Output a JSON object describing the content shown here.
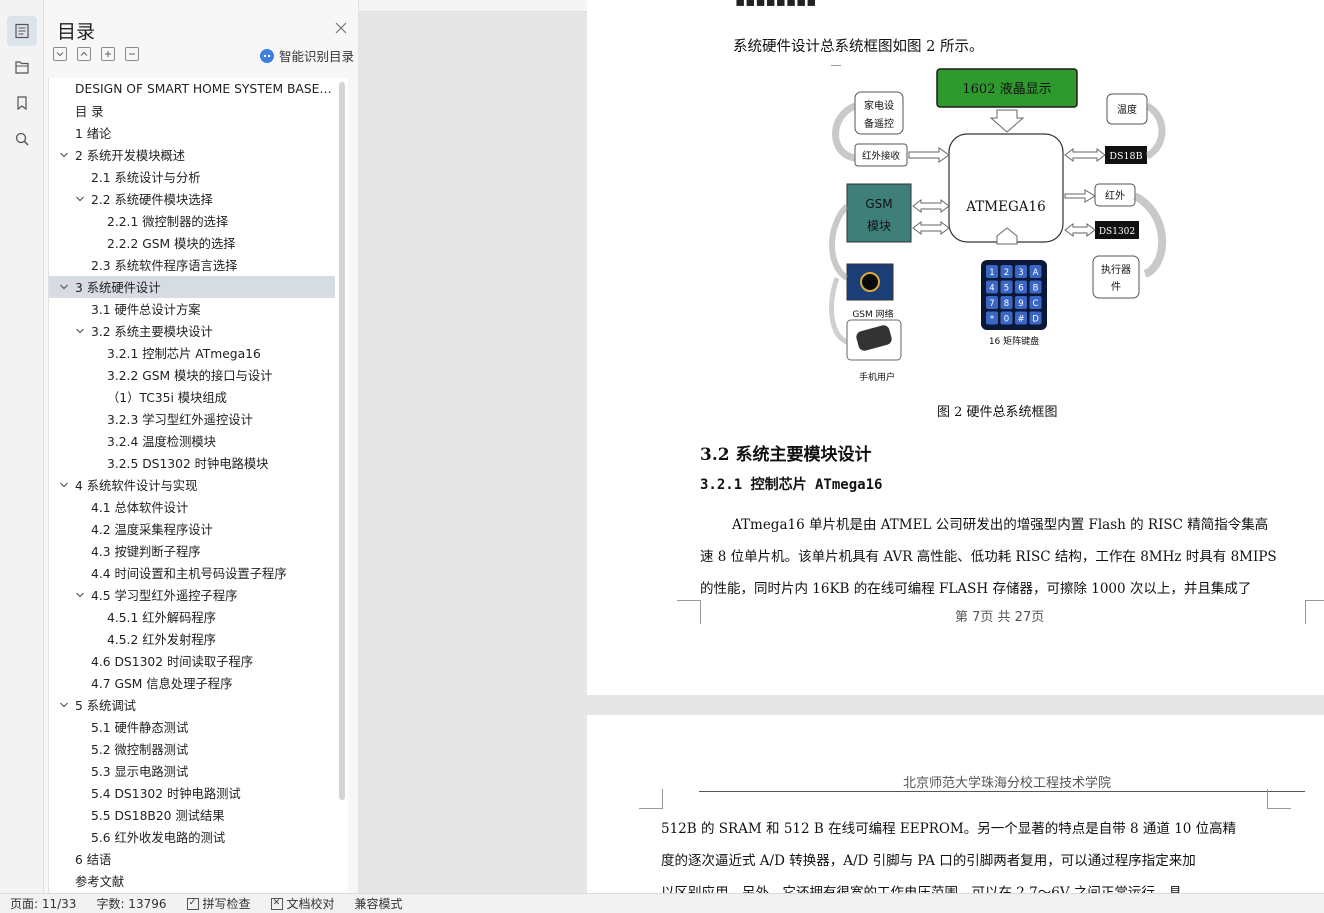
{
  "toc": {
    "title": "目录",
    "smart_label": "智能识别目录",
    "items": [
      {
        "label": "DESIGN OF SMART HOME SYSTEM BASE…",
        "level": 0,
        "caret": false
      },
      {
        "label": "目 录",
        "level": 0,
        "caret": false
      },
      {
        "label": "1  绪论",
        "level": 0,
        "caret": false
      },
      {
        "label": "2  系统开发模块概述",
        "level": 0,
        "caret": true
      },
      {
        "label": "2.1  系统设计与分析",
        "level": 1,
        "caret": false
      },
      {
        "label": "2.2  系统硬件模块选择",
        "level": 1,
        "caret": true
      },
      {
        "label": "2.2.1  微控制器的选择",
        "level": 2,
        "caret": false
      },
      {
        "label": "2.2.2 GSM 模块的选择",
        "level": 2,
        "caret": false
      },
      {
        "label": "2.3  系统软件程序语言选择",
        "level": 1,
        "caret": false
      },
      {
        "label": "3  系统硬件设计",
        "level": 0,
        "caret": true,
        "selected": true
      },
      {
        "label": "3.1  硬件总设计方案",
        "level": 1,
        "caret": false
      },
      {
        "label": "3.2  系统主要模块设计",
        "level": 1,
        "caret": true
      },
      {
        "label": "3.2.1  控制芯片 ATmega16",
        "level": 2,
        "caret": false
      },
      {
        "label": "3.2.2 GSM 模块的接口与设计",
        "level": 2,
        "caret": false
      },
      {
        "label": "（1）TC35i 模块组成",
        "level": 2,
        "caret": false
      },
      {
        "label": "3.2.3  学习型红外遥控设计",
        "level": 2,
        "caret": false
      },
      {
        "label": "3.2.4  温度检测模块",
        "level": 2,
        "caret": false
      },
      {
        "label": "3.2.5 DS1302 时钟电路模块",
        "level": 2,
        "caret": false
      },
      {
        "label": "4  系统软件设计与实现",
        "level": 0,
        "caret": true
      },
      {
        "label": "4.1  总体软件设计",
        "level": 1,
        "caret": false
      },
      {
        "label": "4.2  温度采集程序设计",
        "level": 1,
        "caret": false
      },
      {
        "label": "4.3  按键判断子程序",
        "level": 1,
        "caret": false
      },
      {
        "label": "4.4  时间设置和主机号码设置子程序",
        "level": 1,
        "caret": false
      },
      {
        "label": "4.5  学习型红外遥控子程序",
        "level": 1,
        "caret": true
      },
      {
        "label": "4.5.1  红外解码程序",
        "level": 2,
        "caret": false
      },
      {
        "label": "4.5.2  红外发射程序",
        "level": 2,
        "caret": false
      },
      {
        "label": "4.6 DS1302 时间读取子程序",
        "level": 1,
        "caret": false
      },
      {
        "label": "4.7 GSM 信息处理子程序",
        "level": 1,
        "caret": false
      },
      {
        "label": "5  系统调试",
        "level": 0,
        "caret": true
      },
      {
        "label": "5.1  硬件静态测试",
        "level": 1,
        "caret": false
      },
      {
        "label": "5.2  微控制器测试",
        "level": 1,
        "caret": false
      },
      {
        "label": "5.3  显示电路测试",
        "level": 1,
        "caret": false
      },
      {
        "label": "5.4 DS1302 时钟电路测试",
        "level": 1,
        "caret": false
      },
      {
        "label": "5.5 DS18B20 测试结果",
        "level": 1,
        "caret": false
      },
      {
        "label": "5.6  红外收发电路的测试",
        "level": 1,
        "caret": false
      },
      {
        "label": "6  结语",
        "level": 0,
        "caret": false
      },
      {
        "label": "参考文献",
        "level": 0,
        "caret": false
      }
    ]
  },
  "page1": {
    "intro": "系统硬件设计总系统框图如图 2 所示。",
    "figure_caption": "图 2  硬件总系统框图",
    "section_heading": "3.2  系统主要模块设计",
    "subsection_heading": "3.2.1  控制芯片 ATmega16",
    "para_line1": "ATmega16 单片机是由 ATMEL 公司研发出的增强型内置 Flash 的 RISC 精简指令集高",
    "para_line2": "速 8 位单片机。该单片机具有 AVR 高性能、低功耗 RISC 结构，工作在 8MHz 时具有 8MIPS",
    "para_line3": "的性能，同时片内 16KB 的在线可编程 FLASH 存储器，可擦除 1000 次以上，并且集成了",
    "footer": "第 7页  共 27页"
  },
  "diagram": {
    "lcd": "1602 液晶显示",
    "appliance_line1": "家电设",
    "appliance_line2": "备遥控",
    "temp": "温度",
    "ir_receive": "红外接收",
    "ds18b": "DS18B",
    "mcu": "ATMEGA16",
    "gsm_line1": "GSM",
    "gsm_line2": "模块",
    "ir": "红外",
    "ds1302": "DS1302",
    "actuator_line1": "执行器",
    "actuator_line2": "件",
    "gsm_net": "GSM 网络",
    "keypad": "16 矩阵键盘",
    "phone_user": "手机用户",
    "keys": [
      "1",
      "2",
      "3",
      "A",
      "4",
      "5",
      "6",
      "B",
      "7",
      "8",
      "9",
      "C",
      "*",
      "0",
      "#",
      "D"
    ]
  },
  "page2": {
    "header": "北京师范大学珠海分校工程技术学院",
    "line1": "512B 的 SRAM 和 512 B 在线可编程 EEPROM。另一个显著的特点是自带 8 通道 10 位高精",
    "line2": "度的逐次逼近式 A/D 转换器，A/D 引脚与 PA 口的引脚两者复用，可以通过程序指定来加",
    "line3": "以区别应用。另外，它还拥有很宽的工作电压范围，可以在 2.7～6V 之间正常运行，具"
  },
  "status": {
    "page": "页面: 11/33",
    "words": "字数: 13796",
    "spell": "拼写检查",
    "proof": "文档校对",
    "compat": "兼容模式"
  },
  "colors": {
    "lcd_green": "#2e9a2e",
    "gsm_teal": "#3f7f7a",
    "selected_row": "#d7dce2",
    "accent_blue": "#3b7fe0"
  }
}
